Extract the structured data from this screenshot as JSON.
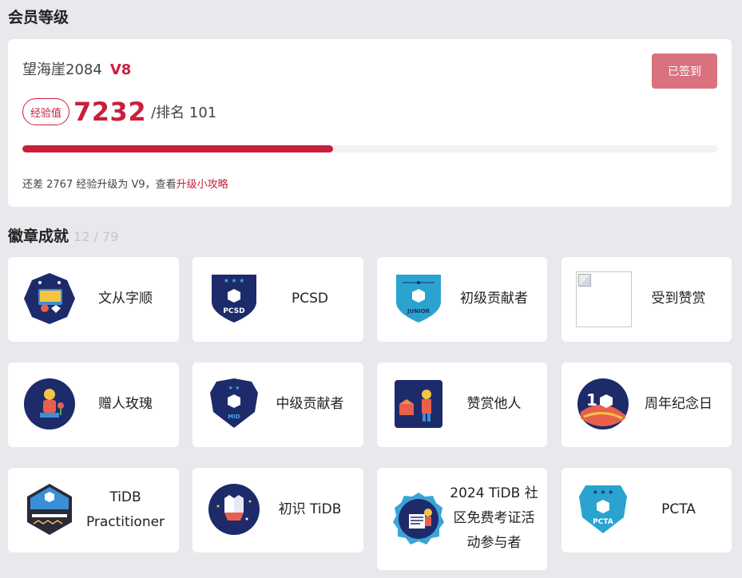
{
  "level_section": {
    "title": "会员等级",
    "username": "望海崖2084",
    "level": "V8",
    "checkin_label": "已签到",
    "exp_tag": "经验值",
    "exp_value": "7232",
    "rank_text": "/排名 101",
    "progress_fraction": 0.447,
    "hint_prefix": "还差 2767 经验升级为 V9，查看",
    "hint_link": "升级小攻略"
  },
  "badges_section": {
    "title": "徽章成就",
    "count": "12 / 79",
    "badges": [
      {
        "label": "文从字顺",
        "icon": "wencongzishun-badge-icon"
      },
      {
        "label": "PCSD",
        "icon": "pcsd-badge-icon"
      },
      {
        "label": "初级贡献者",
        "icon": "junior-contributor-badge-icon"
      },
      {
        "label": "受到赞赏",
        "icon": "broken-image-icon"
      },
      {
        "label": "赠人玫瑰",
        "icon": "rose-gift-badge-icon"
      },
      {
        "label": "中级贡献者",
        "icon": "mid-contributor-badge-icon"
      },
      {
        "label": "赞赏他人",
        "icon": "appreciate-others-badge-icon"
      },
      {
        "label": "周年纪念日",
        "icon": "anniversary-badge-icon"
      },
      {
        "label_lines": [
          "TiDB",
          "Practitioner"
        ],
        "icon": "tidb-practitioner-badge-icon"
      },
      {
        "label": "初识 TiDB",
        "icon": "first-tidb-badge-icon"
      },
      {
        "label_lines": [
          "2024 TiDB 社",
          "区免费考证活",
          "动参与者"
        ],
        "icon": "2024-exam-badge-icon"
      },
      {
        "label": "PCTA",
        "icon": "pcta-badge-icon"
      }
    ],
    "icon_texts": {
      "pcsd": "PCSD",
      "junior": "JUNIOR",
      "mid": "MID",
      "pcta": "PCTA",
      "anniversary_num": "1"
    }
  },
  "colors": {
    "accent": "#c8203c",
    "checkin_bg": "#d9727f",
    "navy": "#1d2b6b",
    "cyan": "#2aa3cf"
  }
}
